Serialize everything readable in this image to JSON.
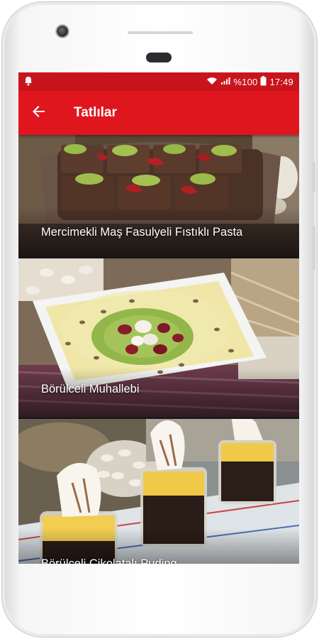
{
  "status_bar": {
    "battery_text": "%100",
    "time": "17:49",
    "icons": [
      "notification-icon",
      "wifi-icon",
      "signal-icon",
      "battery-icon"
    ]
  },
  "app_bar": {
    "title": "Tatlılar",
    "back_icon": "arrow-back-icon"
  },
  "recipes": [
    {
      "title": "Mercimekli Maş Fasulyeli Fıstıklı Pasta"
    },
    {
      "title": "Börülceli Muhallebi"
    },
    {
      "title": "Börülceli Çikolatalı Puding"
    }
  ],
  "colors": {
    "status_bar": "#c9141c",
    "app_bar": "#e0161e",
    "title_text": "#ffffff"
  }
}
